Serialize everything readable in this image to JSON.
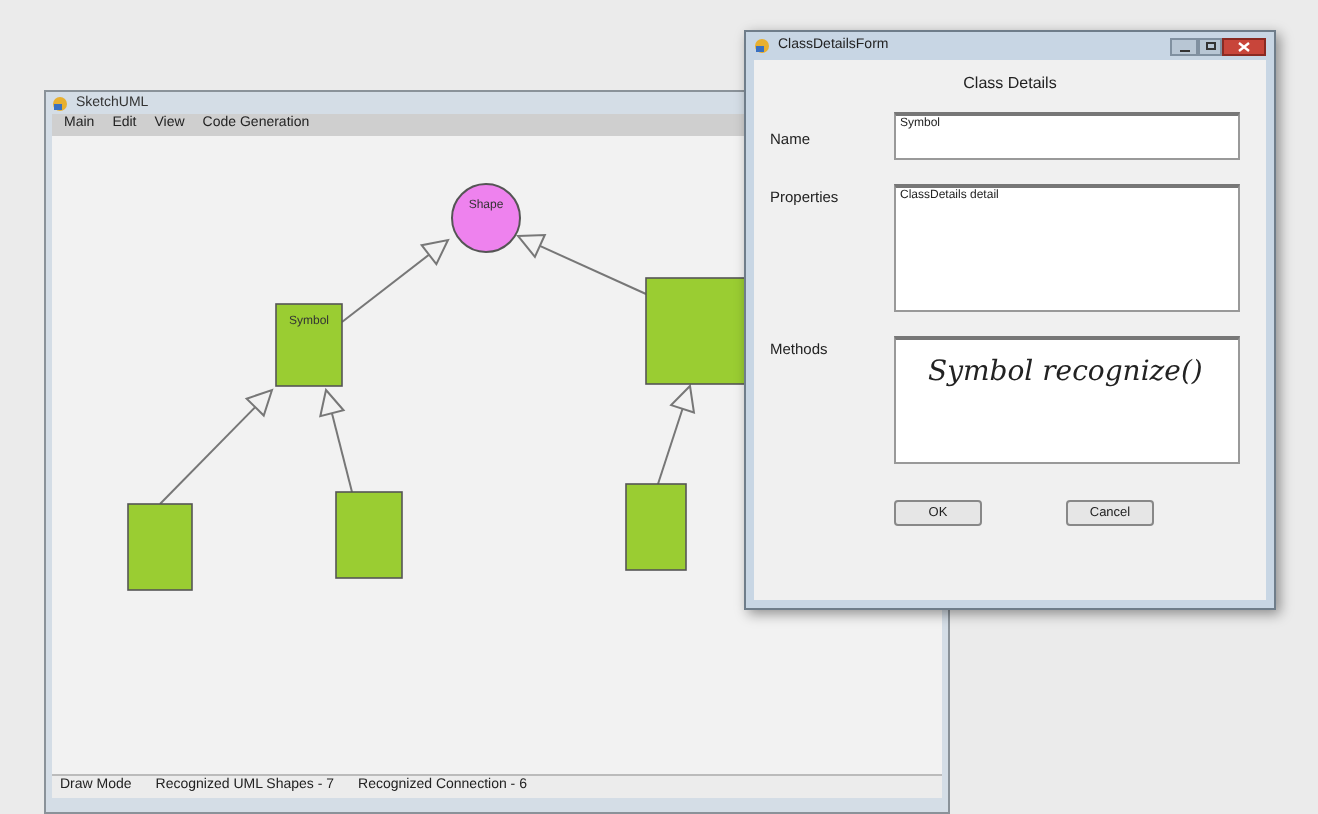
{
  "main_window": {
    "title": "SketchUML",
    "menu": [
      "Main",
      "Edit",
      "View",
      "Code Generation"
    ],
    "diagram": {
      "nodes": [
        {
          "kind": "circle",
          "label": "Shape",
          "color": "#ee82ee"
        },
        {
          "kind": "class",
          "label": "Symbol",
          "color": "#9acd32"
        },
        {
          "kind": "class",
          "color": "#9acd32"
        },
        {
          "kind": "class",
          "color": "#9acd32"
        },
        {
          "kind": "class",
          "color": "#9acd32"
        },
        {
          "kind": "class",
          "color": "#9acd32"
        }
      ],
      "connections": [
        {
          "kind": "inheritance"
        },
        {
          "kind": "inheritance"
        },
        {
          "kind": "inheritance"
        },
        {
          "kind": "inheritance"
        },
        {
          "kind": "inheritance"
        }
      ]
    },
    "status_bar": [
      "Draw Mode",
      "Recognized UML Shapes - 7",
      "Recognized Connection - 6"
    ]
  },
  "dialog": {
    "title": "ClassDetailsForm",
    "heading": "Class Details",
    "fields": [
      {
        "label": "Name",
        "value": "Symbol",
        "kind": "typed"
      },
      {
        "label": "Properties",
        "value": "ClassDetails detail",
        "kind": "typed"
      },
      {
        "label": "Methods",
        "value": "Symbol recognize()",
        "kind": "ink"
      }
    ],
    "buttons": [
      "OK",
      "Cancel"
    ]
  }
}
